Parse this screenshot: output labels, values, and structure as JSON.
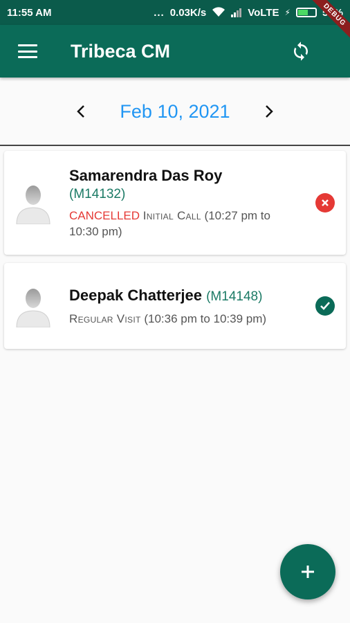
{
  "status_bar": {
    "time": "11:55 AM",
    "dots": "...",
    "speed": "0.03K/s",
    "network": "VoLTE",
    "battery": "53%"
  },
  "debug_banner": "DEBUG",
  "app_bar": {
    "title": "Tribeca CM",
    "menu_icon": "hamburger-icon",
    "sync_icon": "sync-icon"
  },
  "date_nav": {
    "date": "Feb 10, 2021",
    "prev_icon": "chevron-left-icon",
    "next_icon": "chevron-right-icon"
  },
  "visits": [
    {
      "name": "Samarendra Das Roy",
      "code": "(M14132)",
      "status_label": "CANCELLED",
      "type": "Initial Call",
      "time": "(10:27 pm to 10:30 pm)",
      "status": "cancelled",
      "status_color": "#e53935"
    },
    {
      "name": "Deepak Chatterjee",
      "code": "(M14148)",
      "type": "Regular Visit",
      "time": "(10:36 pm to 10:39 pm)",
      "status": "completed",
      "status_color": "#0b6b58"
    }
  ],
  "fab": {
    "icon": "plus-icon"
  },
  "colors": {
    "primary": "#0b6b58",
    "accent": "#2196f3",
    "cancel": "#e53935"
  }
}
